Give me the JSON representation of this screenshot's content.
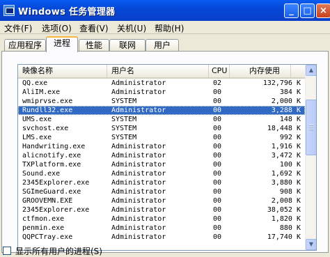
{
  "window": {
    "title": "Windows 任务管理器",
    "minimize_label": "_",
    "maximize_label": "□",
    "close_label": "×"
  },
  "menu": [
    "文件(F)",
    "选项(O)",
    "查看(V)",
    "关机(U)",
    "帮助(H)"
  ],
  "tabs": [
    "应用程序",
    "进程",
    "性能",
    "联网",
    "用户"
  ],
  "active_tab": "进程",
  "table": {
    "headers": [
      "映像名称",
      "用户名",
      "CPU",
      "内存使用"
    ],
    "selected_row": 3,
    "rows": [
      [
        "QQ.exe",
        "Administrator",
        "02",
        "132,796 K"
      ],
      [
        "AliIM.exe",
        "Administrator",
        "00",
        "384 K"
      ],
      [
        "wmiprvse.exe",
        "SYSTEM",
        "00",
        "2,000 K"
      ],
      [
        "Rundll32.exe",
        "Administrator",
        "00",
        "3,288 K"
      ],
      [
        "UMS.exe",
        "SYSTEM",
        "00",
        "148 K"
      ],
      [
        "svchost.exe",
        "SYSTEM",
        "00",
        "18,448 K"
      ],
      [
        "LMS.exe",
        "SYSTEM",
        "00",
        "992 K"
      ],
      [
        "Handwriting.exe",
        "Administrator",
        "00",
        "1,916 K"
      ],
      [
        "alicnotify.exe",
        "Administrator",
        "00",
        "3,472 K"
      ],
      [
        "TXPlatform.exe",
        "Administrator",
        "00",
        "100 K"
      ],
      [
        "Sound.exe",
        "Administrator",
        "00",
        "1,692 K"
      ],
      [
        "2345Explorer.exe",
        "Administrator",
        "00",
        "3,880 K"
      ],
      [
        "SGImeGuard.exe",
        "Administrator",
        "00",
        "908 K"
      ],
      [
        "GROOVEMN.EXE",
        "Administrator",
        "00",
        "2,008 K"
      ],
      [
        "2345Explorer.exe",
        "Administrator",
        "00",
        "38,052 K"
      ],
      [
        "ctfmon.exe",
        "Administrator",
        "00",
        "1,820 K"
      ],
      [
        "penmin.exe",
        "Administrator",
        "00",
        "880 K"
      ],
      [
        "QQPCTray.exe",
        "Administrator",
        "00",
        "17,740 K"
      ]
    ]
  },
  "scrollbar": {
    "up_glyph": "▲",
    "down_glyph": "▼"
  },
  "bottom": {
    "show_all_processes_label": "显示所有用户的进程(S)"
  },
  "colors": {
    "title_bar": "#0a5cf0",
    "selection": "#316ac5",
    "active_tab_accent": "#f9b83d"
  }
}
